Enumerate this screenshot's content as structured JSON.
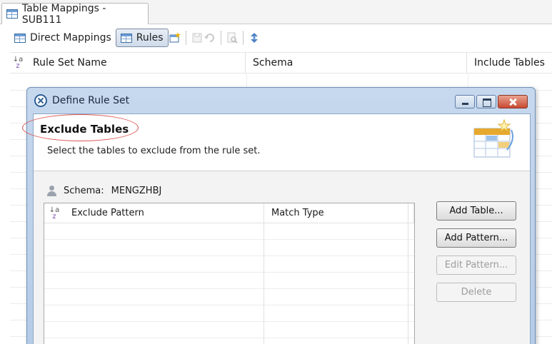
{
  "editor": {
    "tab_title": "Table Mappings - SUB111"
  },
  "toolbar": {
    "direct_mappings": "Direct Mappings",
    "rules": "Rules"
  },
  "rules_grid": {
    "columns": [
      "Rule Set Name",
      "Schema",
      "Include Tables"
    ]
  },
  "dialog": {
    "title": "Define Rule Set",
    "banner_title": "Exclude Tables",
    "banner_description": "Select the tables to exclude from the rule set.",
    "schema_label": "Schema:",
    "schema_value": "MENGZHBJ",
    "table_columns": [
      "Exclude Pattern",
      "Match Type"
    ],
    "buttons": {
      "add_table": "Add Table...",
      "add_pattern": "Add Pattern...",
      "edit_pattern": "Edit Pattern...",
      "delete": "Delete"
    }
  },
  "colors": {
    "highlight": "#d9534f",
    "dialog_frame": "#b4cbe6"
  }
}
